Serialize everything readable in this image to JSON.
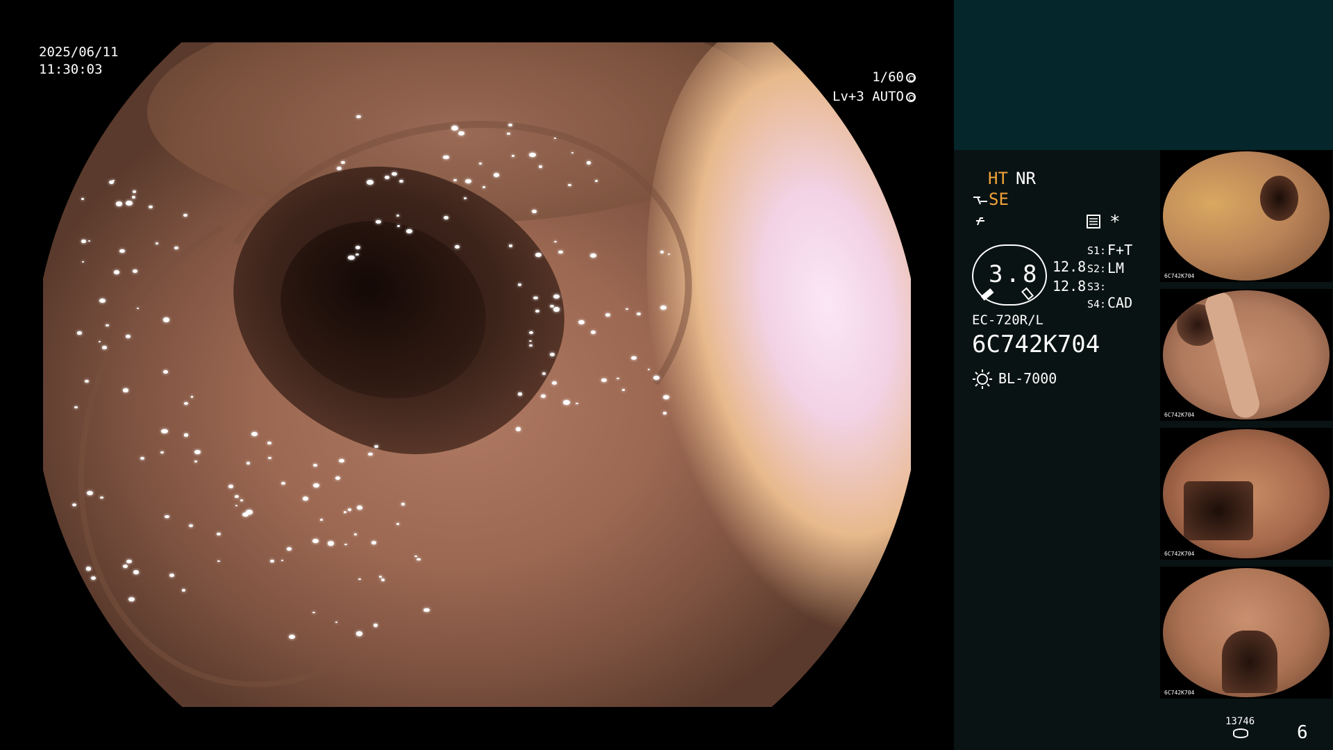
{
  "overlay": {
    "date": "2025/06/11",
    "time": "11:30:03",
    "shutter": "1/60",
    "level": "Lv+3 AUTO"
  },
  "panel": {
    "mode_ht": "HT",
    "mode_nr": "NR",
    "mode_se": "SE",
    "asterisk": "*",
    "magnification": "3.8",
    "value_top": "12.8",
    "value_bottom": "12.8",
    "s1_key": "S1:",
    "s1_val": "F+T",
    "s2_key": "S2:",
    "s2_val": "LM",
    "s3_key": "S3:",
    "s3_val": "",
    "s4_key": "S4:",
    "s4_val": "CAD",
    "scope_model": "EC-720R/L",
    "scope_serial": "6C742K704",
    "light_source": "BL-7000",
    "storage_count": "13746",
    "capture_count": "6"
  },
  "thumbnails": [
    {
      "label": "6C742K704",
      "tone": "#c99a55"
    },
    {
      "label": "6C742K704",
      "tone": "#b78266"
    },
    {
      "label": "6C742K704",
      "tone": "#a76a4c"
    },
    {
      "label": "6C742K704",
      "tone": "#aa7152"
    }
  ],
  "colors": {
    "accent": "#f2a33a",
    "panel_top": "#05272b",
    "panel_bg": "#0a1313"
  },
  "icons": {
    "shutter": "shutter-icon",
    "auto": "auto-iris-icon",
    "se": "structure-enhance-icon",
    "filter": "filter-icon",
    "record": "record-settings-icon",
    "light": "light-source-icon",
    "storage": "storage-disk-icon"
  }
}
